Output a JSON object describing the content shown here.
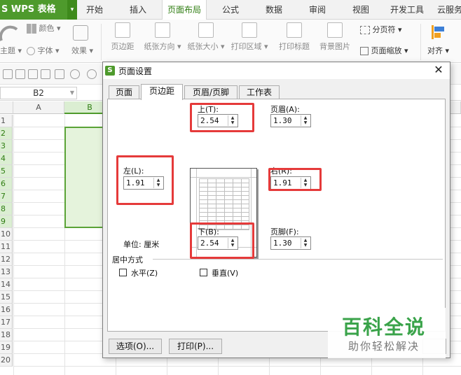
{
  "app": {
    "badge": "S WPS 表格",
    "badge_arrow": "▾"
  },
  "tabs": [
    {
      "label": "开始",
      "active": false
    },
    {
      "label": "插入",
      "active": false
    },
    {
      "label": "页面布局",
      "active": true
    },
    {
      "label": "公式",
      "active": false
    },
    {
      "label": "数据",
      "active": false
    },
    {
      "label": "审阅",
      "active": false
    },
    {
      "label": "视图",
      "active": false
    },
    {
      "label": "开发工具",
      "active": false
    },
    {
      "label": "云服务",
      "active": false
    }
  ],
  "ribbon": {
    "theme": "主题 ▾",
    "colors": "颜色 ▾",
    "fonts": "字体 ▾",
    "effects": "效果 ▾",
    "margins": "页边距",
    "orientation": "纸张方向 ▾",
    "size": "纸张大小 ▾",
    "print_area": "打印区域 ▾",
    "print_titles": "打印标题",
    "background": "背景图片",
    "page_break": "分页符 ▾",
    "page_scale": "页面缩放 ▾",
    "align": "对齐 ▾"
  },
  "namebox": {
    "value": "B2"
  },
  "sheet": {
    "columns": [
      "A",
      "B"
    ],
    "rows": [
      "1",
      "2",
      "3",
      "4",
      "5",
      "6",
      "7",
      "8",
      "9",
      "10",
      "11",
      "12",
      "13",
      "14",
      "15",
      "16",
      "17",
      "18",
      "19",
      "20"
    ],
    "selected_column": "B",
    "selected_rows": [
      "2",
      "3",
      "4",
      "5",
      "6",
      "7",
      "8",
      "9"
    ]
  },
  "dialog": {
    "title": "页面设置",
    "close": "✕",
    "logo": "S",
    "tabs": [
      {
        "label": "页面",
        "active": false
      },
      {
        "label": "页边距",
        "active": true
      },
      {
        "label": "页眉/页脚",
        "active": false
      },
      {
        "label": "工作表",
        "active": false
      }
    ],
    "top": {
      "label": "上(T):",
      "value": "2.54"
    },
    "bottom": {
      "label": "下(B):",
      "value": "2.54"
    },
    "left": {
      "label": "左(L):",
      "value": "1.91"
    },
    "right": {
      "label": "右(R):",
      "value": "1.91"
    },
    "header": {
      "label": "页眉(A):",
      "value": "1.30"
    },
    "footer": {
      "label": "页脚(F):",
      "value": "1.30"
    },
    "unit_label": "单位: 厘米",
    "center_group": "居中方式",
    "horizontal": {
      "label": "水平(Z)",
      "checked": false
    },
    "vertical": {
      "label": "垂直(V)",
      "checked": false
    },
    "options_button": "选项(O)...",
    "print_button": "打印(P)...",
    "spin_up": "▲",
    "spin_down": "▼"
  },
  "watermark": {
    "title": "百科全说",
    "subtitle": "助你轻松解决"
  },
  "colors": {
    "accent": "#4e9a2c",
    "highlight": "#e53a3a",
    "watermark": "#3aa34a"
  }
}
